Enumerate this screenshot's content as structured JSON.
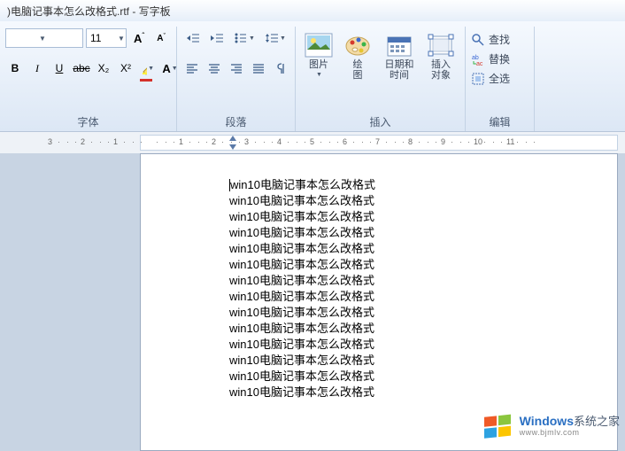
{
  "title": ")电脑记事本怎么改格式.rtf - 写字板",
  "font": {
    "size": "11",
    "increase_tip": "A",
    "decrease_tip": "A",
    "bold": "B",
    "italic": "I",
    "underline": "U",
    "strike": "abc",
    "sub": "X₂",
    "sup": "X²",
    "label": "字体"
  },
  "para": {
    "label": "段落"
  },
  "insert": {
    "picture": "图片",
    "paint": "绘\n图",
    "datetime": "日期和\n时间",
    "object": "插入\n对象",
    "label": "插入"
  },
  "edit": {
    "find": "查找",
    "replace": "替换",
    "selectall": "全选",
    "label": "编辑"
  },
  "ruler": {
    "marks": [
      "3",
      "2",
      "1",
      "",
      "1",
      "2",
      "3",
      "4",
      "5",
      "6",
      "7",
      "8",
      "9",
      "10",
      "11"
    ]
  },
  "document": {
    "line": "win10电脑记事本怎么改格式",
    "repeat": 14
  },
  "watermark": {
    "brand": "Windows",
    "sub": "www.bjmlv.com",
    "suffix": "系统之家"
  }
}
